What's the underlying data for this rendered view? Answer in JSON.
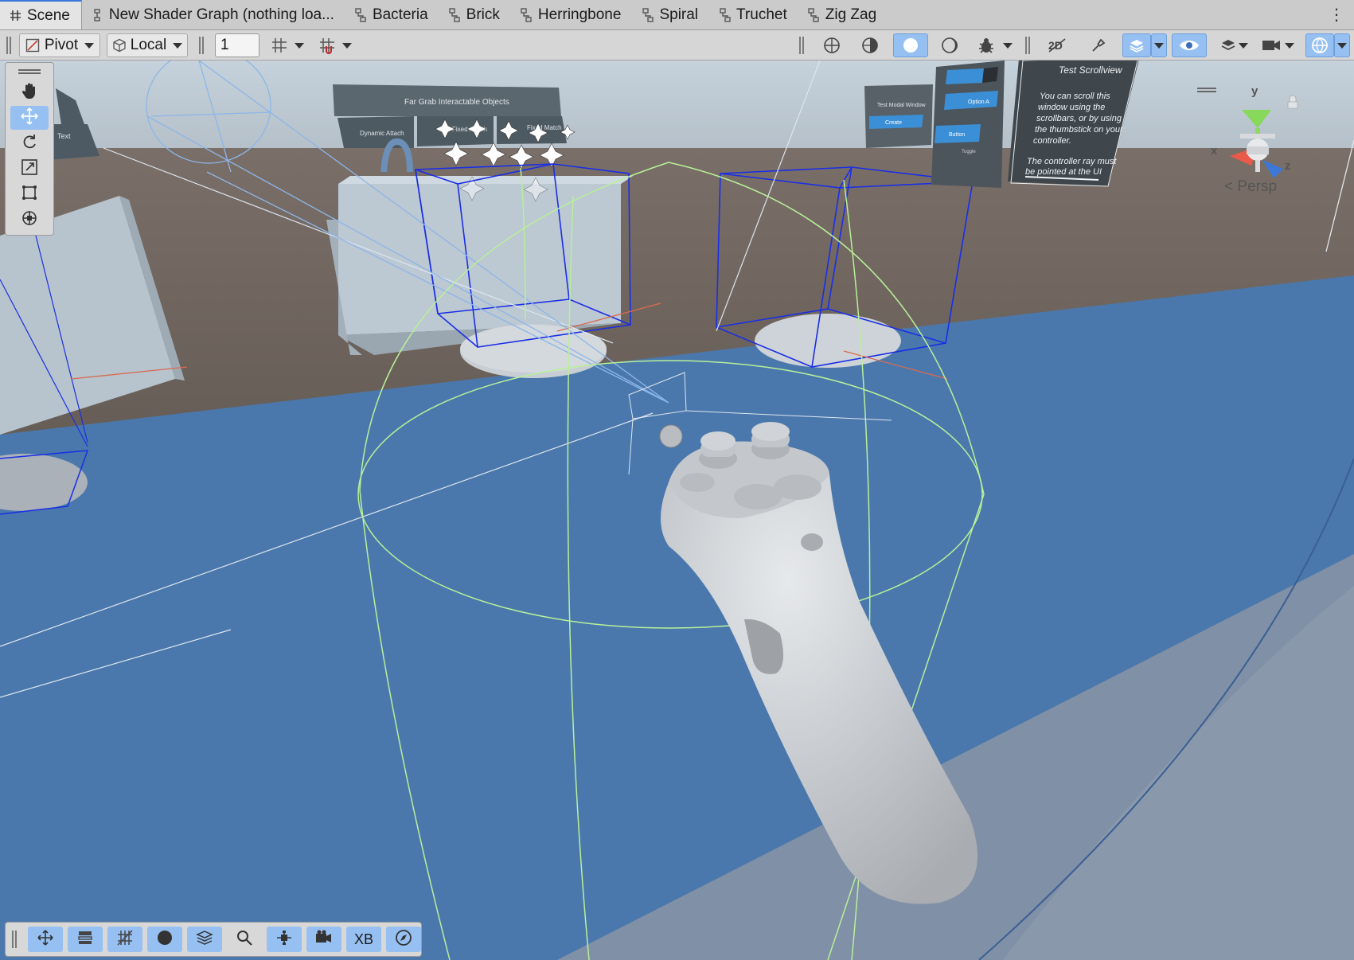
{
  "tabs": [
    {
      "label": "Scene",
      "icon": "grid-hash-icon",
      "active": true
    },
    {
      "label": "New Shader Graph (nothing loa...",
      "icon": "shader-graph-icon",
      "active": false
    },
    {
      "label": "Bacteria",
      "icon": "shader-graph-icon",
      "active": false
    },
    {
      "label": "Brick",
      "icon": "shader-graph-icon",
      "active": false
    },
    {
      "label": "Herringbone",
      "icon": "shader-graph-icon",
      "active": false
    },
    {
      "label": "Spiral",
      "icon": "shader-graph-icon",
      "active": false
    },
    {
      "label": "Truchet",
      "icon": "shader-graph-icon",
      "active": false
    },
    {
      "label": "Zig Zag",
      "icon": "shader-graph-icon",
      "active": false
    }
  ],
  "toolbar": {
    "pivot_label": "Pivot",
    "local_label": "Local",
    "grid_size_value": "1",
    "right_tools": [
      "draw-mode-globe-icon",
      "shading-half-icon",
      "shading-solid-icon",
      "shading-outline-icon",
      "debug-bug-icon",
      "2d-toggle-icon",
      "lighting-toggle-icon",
      "effects-layers-icon",
      "visibility-eye-icon",
      "layers-icon",
      "camera-icon",
      "gizmos-globe-icon"
    ]
  },
  "view_tools": [
    "hand-icon",
    "move-icon",
    "rotate-icon",
    "scale-icon",
    "rect-transform-icon",
    "transform-icon"
  ],
  "bottom_tools": {
    "items": [
      "move-icon",
      "sliders-icon",
      "grid-snap-icon",
      "sphere-icon",
      "layers-stack-icon",
      "search-icon",
      "pivot-cross-icon",
      "camera-video-icon",
      "xb-text",
      "compass-icon"
    ],
    "xb_label": "XB"
  },
  "gizmo": {
    "y": "y",
    "x": "x",
    "z": "z",
    "projection": "Persp"
  },
  "scene_text": {
    "panel_title": "Far Grab Interactable Objects",
    "panel_buttons": [
      "Dynamic Attach",
      "Fixed Attach",
      "Fixed Match"
    ],
    "left_panel_text": "Text",
    "modal_title": "Test Modal Window",
    "modal_button": "Create",
    "ui_option": "Option A",
    "ui_button": "Button",
    "ui_toggle": "Toggle",
    "scroll_title": "Test Scrollview",
    "scroll_body_1": "You can scroll this",
    "scroll_body_2": "window using the",
    "scroll_body_3": "scrollbars, or by using",
    "scroll_body_4": "the thumbstick on your",
    "scroll_body_5": "controller.",
    "scroll_body_6": "The controller ray must",
    "scroll_body_7": "be pointed at the UI"
  },
  "colors": {
    "floor": "#4a78ac",
    "wall": "#6b615a",
    "sky": "#c9d4dc",
    "selection": "#1a2ee6",
    "collider": "#b8f09a",
    "accent": "#96c0f2"
  }
}
